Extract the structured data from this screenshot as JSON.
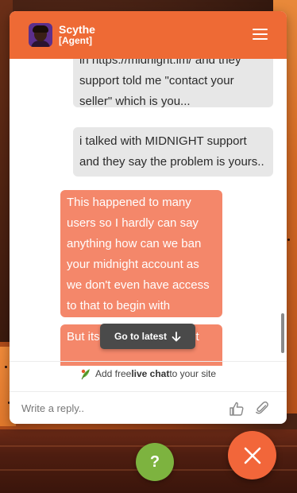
{
  "header": {
    "agent_name": "Scythe",
    "agent_role": "[Agent]",
    "avatar_icon": "agent-avatar",
    "menu_icon": "hamburger-menu-icon"
  },
  "messages": [
    {
      "sender": "visitor",
      "lines": [
        "in https://midnight.im/ and they",
        "support told me \"contact your",
        "seller\" which is you..."
      ]
    },
    {
      "sender": "visitor",
      "lines": [
        "i talked with MIDNIGHT support",
        "and they say the problem is yours.."
      ]
    },
    {
      "sender": "agent",
      "lines": [
        "This happened to many",
        "users so I hardly can say",
        "anything how can we ban",
        "your midnight account as",
        "we don't even have access",
        "to that to begin with"
      ]
    },
    {
      "sender": "agent",
      "lines": [
        "But its",
        "ct"
      ]
    }
  ],
  "go_latest": {
    "label": "Go to latest",
    "icon": "arrow-down-icon"
  },
  "promo": {
    "prefix": "Add free ",
    "bold": "live chat",
    "suffix": " to your site",
    "icon": "leaf-icon"
  },
  "composer": {
    "placeholder": "Write a reply..",
    "value": "",
    "like_icon": "thumbs-up-icon",
    "attach_icon": "paperclip-icon"
  },
  "floating": {
    "help_label": "?",
    "close_icon": "close-icon"
  },
  "colors": {
    "brand_orange": "#ee6a35",
    "agent_bubble": "#f4876a",
    "visitor_bubble": "#e7e7e7",
    "help_green": "#7db33f",
    "close_orange": "#f2663a"
  }
}
